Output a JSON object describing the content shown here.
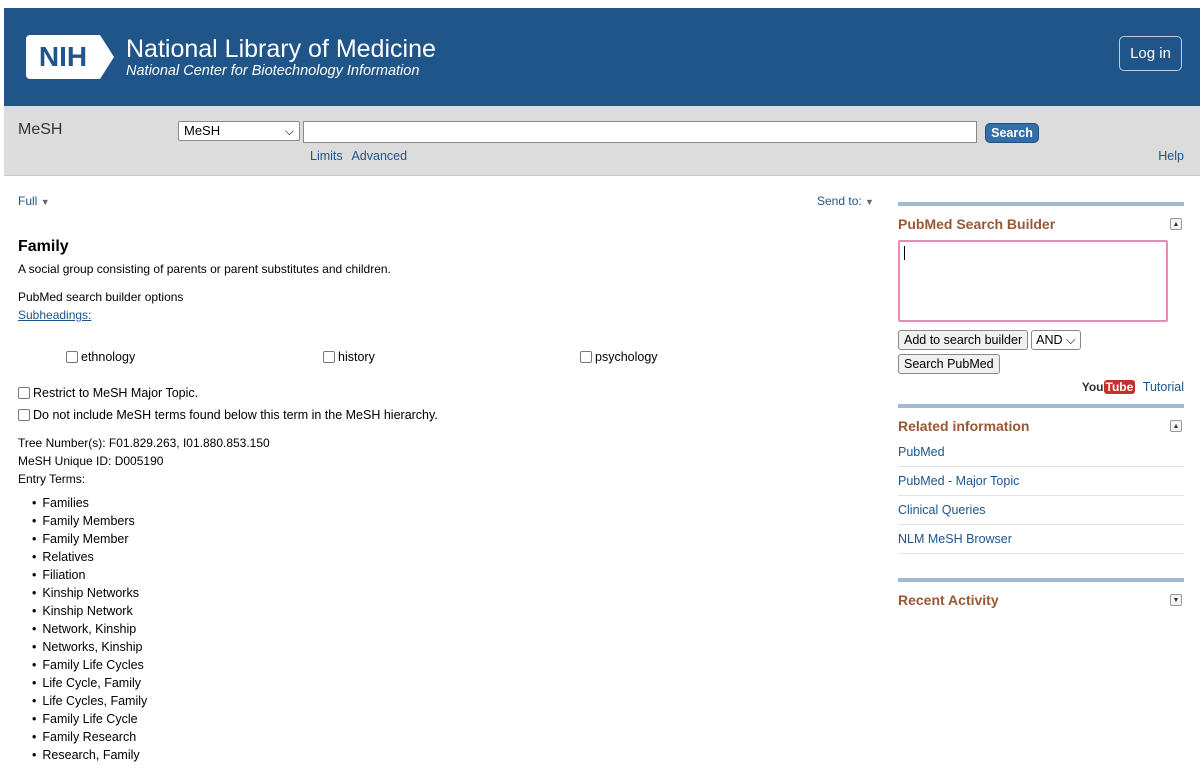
{
  "header": {
    "logo_abbr": "NIH",
    "title": "National Library of Medicine",
    "subtitle": "National Center for Biotechnology Information",
    "login_label": "Log in"
  },
  "searchbar": {
    "db_label": "MeSH",
    "db_selected": "MeSH",
    "term_value": "",
    "search_label": "Search",
    "limits_label": "Limits",
    "advanced_label": "Advanced",
    "help_label": "Help"
  },
  "toolbar": {
    "format_label": "Full",
    "sendto_label": "Send to:"
  },
  "record": {
    "title": "Family",
    "scope_note": "A social group consisting of parents or parent substitutes and children.",
    "builder_options_label": "PubMed search builder options",
    "subheadings_label": "Subheadings:",
    "subheadings": [
      "ethnology",
      "history",
      "psychology"
    ],
    "restrict_major_label": "Restrict to MeSH Major Topic.",
    "no_explode_label": "Do not include MeSH terms found below this term in the MeSH hierarchy.",
    "tree_numbers": "Tree Number(s): F01.829.263, I01.880.853.150",
    "unique_id": "MeSH Unique ID: D005190",
    "entry_terms_label": "Entry Terms:",
    "entry_terms": [
      "Families",
      "Family Members",
      "Family Member",
      "Relatives",
      "Filiation",
      "Kinship Networks",
      "Kinship Network",
      "Network, Kinship",
      "Networks, Kinship",
      "Family Life Cycles",
      "Life Cycle, Family",
      "Life Cycles, Family",
      "Family Life Cycle",
      "Family Research",
      "Research, Family"
    ]
  },
  "sidebar": {
    "builder_title": "PubMed Search Builder",
    "builder_text": "",
    "add_button": "Add to search builder",
    "operator": "AND",
    "search_pubmed_button": "Search PubMed",
    "yt_you": "You",
    "yt_tube": "Tube",
    "tutorial_label": "Tutorial",
    "related_title": "Related information",
    "related_items": [
      "PubMed",
      "PubMed - Major Topic",
      "Clinical Queries",
      "NLM MeSH Browser"
    ],
    "recent_title": "Recent Activity"
  }
}
